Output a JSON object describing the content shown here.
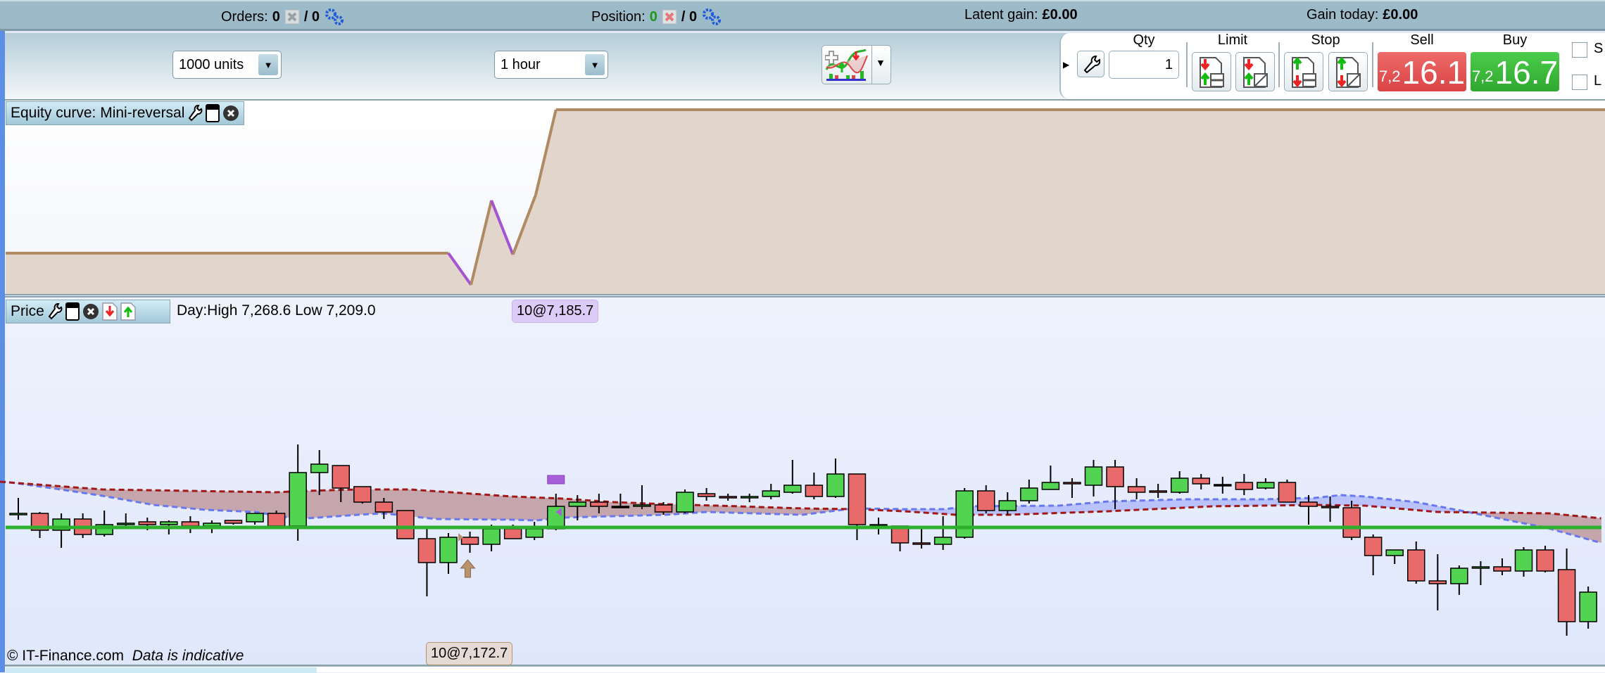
{
  "topbar": {
    "orders_label": "Orders:",
    "orders_count": "0",
    "orders_slash": "/ 0",
    "position_label": "Position:",
    "position_count": "0",
    "position_slash": "/ 0",
    "latent_gain_label": "Latent gain:",
    "latent_gain_value": "£0.00",
    "gain_today_label": "Gain today:",
    "gain_today_value": "£0.00"
  },
  "toolbar": {
    "units_select": "1000 units",
    "timeframe_select": "1 hour"
  },
  "trade": {
    "qty_label": "Qty",
    "qty_value": "1",
    "limit_label": "Limit",
    "stop_label": "Stop",
    "sell_label": "Sell",
    "buy_label": "Buy",
    "sell_prefix": "7,2",
    "sell_price": "16.1",
    "buy_prefix": "7,2",
    "buy_price": "16.7",
    "checkbox_s": "S",
    "checkbox_l": "L",
    "colors": {
      "sell": "#e24f4f",
      "buy": "#36b236"
    }
  },
  "equity_panel": {
    "title": "Equity curve: Mini-reversal"
  },
  "price_panel": {
    "title": "Price",
    "day_range": "Day:High 7,268.6 Low 7,209.0",
    "trade_tag_top": "10@7,185.7",
    "trade_tag_bottom": "10@7,172.7",
    "copyright": "© IT-Finance.com",
    "disclaimer": "Data is indicative"
  },
  "chart_data": [
    {
      "type": "line",
      "title": "Equity curve: Mini-reversal",
      "x_unit": "candle index",
      "points": [
        [
          -0.6,
          0
        ],
        [
          20.0,
          0
        ],
        [
          21.05,
          -45
        ],
        [
          22.0,
          75
        ],
        [
          23.0,
          -2
        ],
        [
          24.06,
          83
        ],
        [
          25.0,
          204
        ],
        [
          73.8,
          204
        ]
      ],
      "colors": {
        "gain": "#b08a62",
        "loss": "#a454d0",
        "fill": "#e2d6cc"
      }
    },
    {
      "type": "candlestick",
      "title": "Price",
      "ylim": [
        7162,
        7196
      ],
      "reference_level": 7180.0,
      "candles": [
        [
          7181.8,
          7184.2,
          7181.1,
          7182.0
        ],
        [
          7182.0,
          7182.2,
          7178.5,
          7179.6
        ],
        [
          7179.6,
          7182.0,
          7177.1,
          7181.2
        ],
        [
          7181.2,
          7182.0,
          7178.5,
          7179.0
        ],
        [
          7179.0,
          7182.4,
          7178.7,
          7180.4
        ],
        [
          7180.4,
          7182.0,
          7180.2,
          7180.6
        ],
        [
          7180.8,
          7181.4,
          7179.6,
          7180.4
        ],
        [
          7180.4,
          7181.0,
          7179.0,
          7180.8
        ],
        [
          7180.8,
          7181.6,
          7179.2,
          7180.2
        ],
        [
          7180.2,
          7181.0,
          7179.2,
          7180.6
        ],
        [
          7181.0,
          7181.0,
          7180.4,
          7180.6
        ],
        [
          7180.8,
          7182.0,
          7180.4,
          7182.0
        ],
        [
          7182.0,
          7182.4,
          7180.2,
          7180.2
        ],
        [
          7180.2,
          7191.8,
          7178.1,
          7187.8
        ],
        [
          7187.8,
          7191.0,
          7184.6,
          7189.0
        ],
        [
          7188.8,
          7188.8,
          7183.6,
          7185.6
        ],
        [
          7185.8,
          7185.8,
          7183.4,
          7183.6
        ],
        [
          7183.6,
          7184.2,
          7181.2,
          7182.2
        ],
        [
          7182.4,
          7182.4,
          7178.4,
          7178.4
        ],
        [
          7178.4,
          7179.8,
          7170.2,
          7175.0
        ],
        [
          7175.0,
          7179.2,
          7173.4,
          7178.6
        ],
        [
          7178.6,
          7179.4,
          7176.4,
          7177.6
        ],
        [
          7177.6,
          7180.4,
          7176.6,
          7179.8
        ],
        [
          7179.8,
          7180.4,
          7178.4,
          7178.4
        ],
        [
          7178.6,
          7180.8,
          7178.2,
          7179.8
        ],
        [
          7179.8,
          7184.8,
          7179.6,
          7183.0
        ],
        [
          7183.0,
          7184.6,
          7181.0,
          7183.6
        ],
        [
          7183.6,
          7184.8,
          7182.0,
          7183.0
        ],
        [
          7183.0,
          7184.8,
          7182.8,
          7183.0
        ],
        [
          7183.0,
          7186.0,
          7182.6,
          7183.2
        ],
        [
          7183.2,
          7183.6,
          7181.8,
          7182.2
        ],
        [
          7182.2,
          7185.4,
          7182.0,
          7185.0
        ],
        [
          7184.8,
          7185.6,
          7183.8,
          7184.4
        ],
        [
          7184.4,
          7184.8,
          7183.8,
          7184.2
        ],
        [
          7184.2,
          7184.8,
          7183.6,
          7184.4
        ],
        [
          7184.4,
          7186.2,
          7184.0,
          7185.2
        ],
        [
          7185.0,
          7189.6,
          7184.8,
          7186.0
        ],
        [
          7186.0,
          7187.8,
          7184.0,
          7184.4
        ],
        [
          7184.4,
          7189.8,
          7184.2,
          7187.6
        ],
        [
          7187.6,
          7187.6,
          7178.2,
          7180.4
        ],
        [
          7180.4,
          7181.4,
          7179.0,
          7180.4
        ],
        [
          7180.2,
          7180.2,
          7176.6,
          7177.8
        ],
        [
          7177.8,
          7180.0,
          7177.0,
          7177.6
        ],
        [
          7177.6,
          7181.6,
          7176.8,
          7178.6
        ],
        [
          7178.6,
          7185.6,
          7178.4,
          7185.2
        ],
        [
          7185.2,
          7186.0,
          7182.0,
          7182.4
        ],
        [
          7182.4,
          7185.0,
          7181.8,
          7183.8
        ],
        [
          7183.8,
          7186.8,
          7183.4,
          7185.6
        ],
        [
          7185.4,
          7188.8,
          7185.4,
          7186.4
        ],
        [
          7186.4,
          7187.0,
          7184.2,
          7186.2
        ],
        [
          7186.0,
          7189.6,
          7184.4,
          7188.6
        ],
        [
          7188.6,
          7189.6,
          7182.6,
          7185.8
        ],
        [
          7185.8,
          7187.0,
          7184.0,
          7185.0
        ],
        [
          7185.2,
          7186.2,
          7184.2,
          7185.0
        ],
        [
          7185.0,
          7188.0,
          7184.8,
          7187.0
        ],
        [
          7187.0,
          7187.6,
          7185.4,
          7186.2
        ],
        [
          7186.1,
          7187.2,
          7184.8,
          7186.1
        ],
        [
          7186.4,
          7187.6,
          7184.6,
          7185.4
        ],
        [
          7185.6,
          7187.0,
          7185.4,
          7186.4
        ],
        [
          7186.4,
          7186.8,
          7183.6,
          7183.6
        ],
        [
          7183.6,
          7184.6,
          7180.4,
          7183.0
        ],
        [
          7183.0,
          7184.4,
          7180.8,
          7182.8
        ],
        [
          7182.8,
          7183.8,
          7178.2,
          7178.6
        ],
        [
          7178.6,
          7179.0,
          7173.2,
          7176.0
        ],
        [
          7176.0,
          7176.8,
          7174.8,
          7176.8
        ],
        [
          7176.8,
          7178.0,
          7172.0,
          7172.4
        ],
        [
          7172.4,
          7176.2,
          7168.2,
          7172.0
        ],
        [
          7172.0,
          7174.6,
          7170.4,
          7174.2
        ],
        [
          7174.2,
          7175.2,
          7171.8,
          7174.4
        ],
        [
          7174.4,
          7175.6,
          7173.2,
          7173.8
        ],
        [
          7173.8,
          7177.2,
          7173.0,
          7176.8
        ],
        [
          7176.8,
          7177.4,
          7173.6,
          7173.8
        ],
        [
          7174.0,
          7177.0,
          7164.6,
          7166.6
        ],
        [
          7166.6,
          7171.6,
          7165.6,
          7170.8
        ]
      ],
      "ma_red": [
        [
          -0.85,
          7186.5
        ],
        [
          3.91,
          7185.4
        ],
        [
          12.0,
          7185.0
        ],
        [
          13.43,
          7185.2
        ],
        [
          15.8,
          7185.4
        ],
        [
          18.2,
          7185.4
        ],
        [
          22.96,
          7184.4
        ],
        [
          25.3,
          7184.1
        ],
        [
          27.7,
          7183.6
        ],
        [
          30.1,
          7183.3
        ],
        [
          32.5,
          7183.1
        ],
        [
          36.46,
          7182.7
        ],
        [
          38.84,
          7182.6
        ],
        [
          41.2,
          7182.3
        ],
        [
          43.6,
          7181.8
        ],
        [
          46.0,
          7181.8
        ],
        [
          50.7,
          7182.3
        ],
        [
          55.5,
          7183.0
        ],
        [
          60.3,
          7183.2
        ],
        [
          62.6,
          7183.1
        ],
        [
          66.0,
          7182.2
        ],
        [
          71.2,
          7182.0
        ],
        [
          73.6,
          7181.3
        ]
      ],
      "ma_blue": [
        [
          -0.85,
          7186.6
        ],
        [
          1.53,
          7185.6
        ],
        [
          3.91,
          7184.5
        ],
        [
          6.3,
          7183.2
        ],
        [
          8.7,
          7182.5
        ],
        [
          11.05,
          7182.2
        ],
        [
          12.96,
          7181.2
        ],
        [
          15.8,
          7181.8
        ],
        [
          17.0,
          7182.0
        ],
        [
          19.4,
          7181.2
        ],
        [
          22.96,
          7181.1
        ],
        [
          24.1,
          7181.0
        ],
        [
          25.3,
          7181.4
        ],
        [
          27.7,
          7181.6
        ],
        [
          30.1,
          7181.8
        ],
        [
          32.0,
          7182.2
        ],
        [
          36.46,
          7181.8
        ],
        [
          38.84,
          7182.7
        ],
        [
          41.2,
          7182.6
        ],
        [
          43.1,
          7182.6
        ],
        [
          44.1,
          7183.0
        ],
        [
          48.4,
          7183.1
        ],
        [
          50.7,
          7183.7
        ],
        [
          54.3,
          7184.0
        ],
        [
          57.9,
          7184.0
        ],
        [
          60.3,
          7184.2
        ],
        [
          61.5,
          7184.6
        ],
        [
          62.6,
          7184.4
        ],
        [
          65.0,
          7183.6
        ],
        [
          67.4,
          7182.2
        ],
        [
          69.8,
          7180.7
        ],
        [
          71.0,
          7180.0
        ],
        [
          73.6,
          7177.8
        ]
      ],
      "trades": [
        {
          "type": "exit",
          "qty": 10,
          "price": 7185.7,
          "candle": 25
        },
        {
          "type": "entry-long",
          "qty": 10,
          "price": 7172.7,
          "candle": 20.9
        }
      ],
      "colors": {
        "up": "#52d452",
        "down": "#e86a6a",
        "ma_red": "#a01818",
        "ma_blue": "#6a78f0",
        "level": "#2eb02e",
        "fill_red": "#c6a6ad",
        "fill_blue": "#b9c2fb"
      }
    }
  ]
}
